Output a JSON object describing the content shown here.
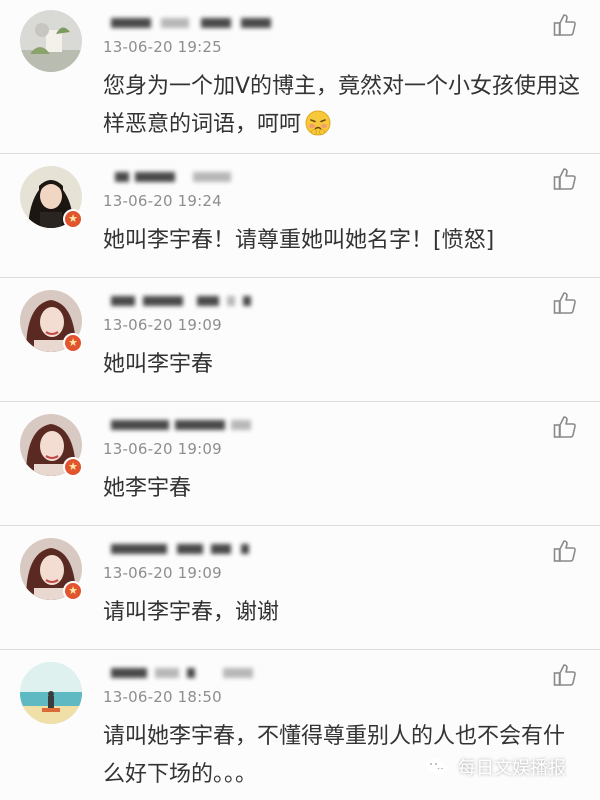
{
  "comments": [
    {
      "time": "13-06-20 19:25",
      "text": "您身为一个加V的博主，竟然对一个小女孩使用这样恶意的词语，呵呵",
      "has_emoji": true,
      "verified": false,
      "avatar": "avatar-flower"
    },
    {
      "time": "13-06-20 19:24",
      "text": "她叫李宇春！请尊重她叫她名字！[愤怒]",
      "has_emoji": false,
      "verified": true,
      "avatar": "avatar-woman-1"
    },
    {
      "time": "13-06-20 19:09",
      "text": "她叫李宇春",
      "has_emoji": false,
      "verified": true,
      "avatar": "avatar-woman-2"
    },
    {
      "time": "13-06-20 19:09",
      "text": "她李宇春",
      "has_emoji": false,
      "verified": true,
      "avatar": "avatar-woman-2"
    },
    {
      "time": "13-06-20 19:09",
      "text": "请叫李宇春，谢谢",
      "has_emoji": false,
      "verified": true,
      "avatar": "avatar-woman-2"
    },
    {
      "time": "13-06-20 18:50",
      "text": "请叫她李宇春，不懂得尊重别人的人也不会有什么好下场的。。。",
      "has_emoji": false,
      "verified": false,
      "avatar": "avatar-beach"
    }
  ],
  "watermark": {
    "text": "每日文娱播报",
    "icon": "wechat-icon"
  },
  "icons": {
    "like": "thumbs-up-icon",
    "verified": "verified-v-badge-icon",
    "emoji": "shy-face-emoji-icon"
  },
  "colors": {
    "timestamp": "#8e8e8e",
    "text": "#333333",
    "badge": "#e0542e",
    "divider": "#dcdcdc"
  }
}
